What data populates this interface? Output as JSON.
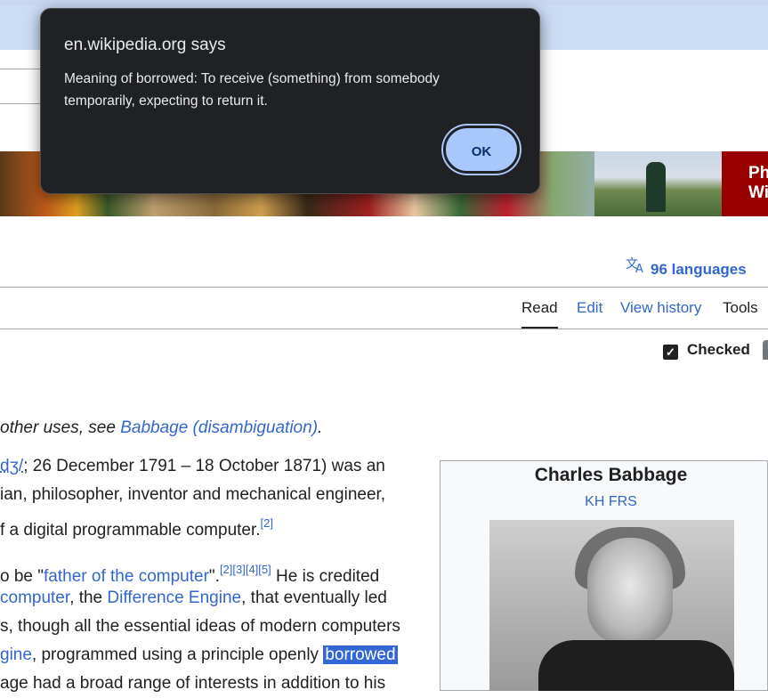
{
  "dialog": {
    "title": "en.wikipedia.org says",
    "message": "Meaning of borrowed: To receive (something) from somebody temporarily, expecting to return it.",
    "ok_label": "OK"
  },
  "banner": {
    "panel_text_1": "Ph",
    "panel_text_2": "Wi"
  },
  "languages": {
    "icon": "translate-icon",
    "label": "96 languages"
  },
  "tabs": {
    "read": "Read",
    "edit": "Edit",
    "history": "View history",
    "tools": "Tools"
  },
  "review": {
    "label": "Checked"
  },
  "hatnote": {
    "prefix": "other uses, see ",
    "link": "Babbage (disambiguation)",
    "suffix": "."
  },
  "article": {
    "p1_line1_link": "dʒ/",
    "p1_line1_rest": "; 26 December 1791 – 18 October 1871) was an",
    "p1_line2": "ian, philosopher, inventor and mechanical engineer,",
    "p1_line3": "f a digital programmable computer.",
    "p1_ref": "[2]",
    "p2_line1_pre": "o be \"",
    "p2_line1_link": "father of the computer",
    "p2_line1_mid": "\".",
    "p2_line1_refs": "[2][3][4][5]",
    "p2_line1_post": " He is credited",
    "p2_line2_link1": "computer",
    "p2_line2_mid": ", the ",
    "p2_line2_link2": "Difference Engine",
    "p2_line2_post": ", that eventually led",
    "p2_line3": "s, though all the essential ideas of modern computers",
    "p2_line4_link": "gine",
    "p2_line4_mid": ", programmed using a principle openly ",
    "p2_line4_highlight": "borrowed",
    "p2_line5": "age had a broad range of interests in addition to his"
  },
  "infobox": {
    "title": "Charles Babbage",
    "subtitle": "KH FRS"
  }
}
